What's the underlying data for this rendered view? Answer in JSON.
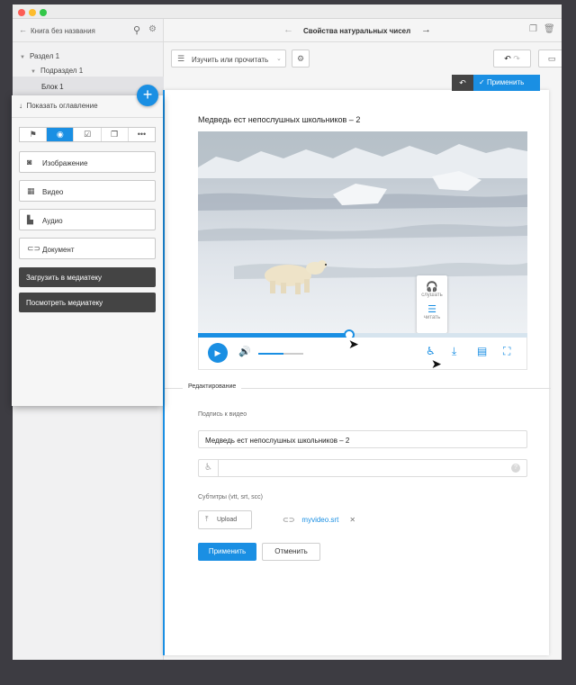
{
  "sidebar": {
    "book_title": "Книга без названия",
    "tree": [
      {
        "label": "Раздел 1"
      },
      {
        "label": "Подраздел 1"
      }
    ],
    "selected_block": "Блок 1"
  },
  "media_popup": {
    "show_toc": "Показать оглавление",
    "tabs": [
      {
        "icon": "flag-icon",
        "active": false
      },
      {
        "icon": "camera-icon",
        "active": true
      },
      {
        "icon": "checkbox-icon",
        "active": false
      },
      {
        "icon": "copy-icon",
        "active": false
      },
      {
        "icon": "more-icon",
        "active": false
      }
    ],
    "items": [
      {
        "label": "Изображение",
        "icon": "image-icon"
      },
      {
        "label": "Видео",
        "icon": "film-icon"
      },
      {
        "label": "Аудио",
        "icon": "audio-file-icon"
      },
      {
        "label": "Документ",
        "icon": "link-icon"
      }
    ],
    "upload_library": "Загрузить в медиатеку",
    "view_library": "Посмотреть медиатеку"
  },
  "topbar": {
    "title": "Свойства натуральных чисел"
  },
  "toolbar": {
    "mode_select": "Изучить или прочитать"
  },
  "apply_bar": {
    "apply": "Применить"
  },
  "video_block": {
    "title": "Медведь ест непослушных школьников – 2",
    "progress": 0.46,
    "volume": 0.55,
    "accessibility_menu": {
      "listen": "слушать",
      "read": "читать"
    }
  },
  "editing": {
    "section_label": "Редактирование",
    "caption_label": "Подпись к видео",
    "caption_value": "Медведь ест непослушных школьников – 2",
    "subtitles_label": "Субтитры (vtt, srt, scc)",
    "upload_label": "Upload",
    "file_name": "myvideo.srt",
    "apply_button": "Применить",
    "cancel_button": "Отменить"
  },
  "colors": {
    "accent": "#1a8fe3",
    "dark_button": "#444444",
    "desktop": "#3d3c42"
  }
}
